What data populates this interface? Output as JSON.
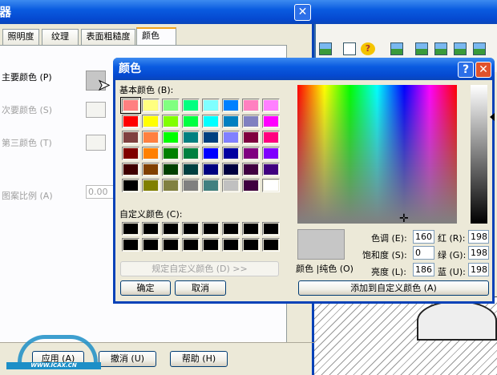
{
  "bg_dialog": {
    "title": "辑器",
    "tabs": [
      "照明度",
      "纹理",
      "表面粗糙度",
      "颜色"
    ],
    "primary_label": "主要颜色 (P)",
    "secondary_label": "次要颜色 (S)",
    "third_label": "第三颜色 (T)",
    "scale_label": "图案比例 (A)",
    "scale_value": "0.00",
    "apply": "应用 (A)",
    "undo": "撤消 (U)",
    "help": "帮助 (H)"
  },
  "color_dialog": {
    "title": "颜色",
    "basic_label": "基本颜色 (B):",
    "custom_label": "自定义颜色 (C):",
    "define_custom": "规定自定义颜色 (D) >>",
    "ok": "确定",
    "cancel": "取消",
    "preview_label": "颜色 |纯色 (O)",
    "hue_label": "色调 (E):",
    "hue": "160",
    "sat_label": "饱和度 (S):",
    "sat": "0",
    "lum_label": "亮度 (L):",
    "lum": "186",
    "red_label": "红 (R):",
    "red": "198",
    "green_label": "绿 (G):",
    "green": "198",
    "blue_label": "蓝 (U):",
    "blue": "198",
    "add_custom": "添加到自定义颜色 (A)",
    "basic_colors": [
      "#ff8080",
      "#ffff80",
      "#80ff80",
      "#00ff80",
      "#80ffff",
      "#0080ff",
      "#ff80c0",
      "#ff80ff",
      "#ff0000",
      "#ffff00",
      "#80ff00",
      "#00ff40",
      "#00ffff",
      "#0080c0",
      "#8080c0",
      "#ff00ff",
      "#804040",
      "#ff8040",
      "#00ff00",
      "#008080",
      "#004080",
      "#8080ff",
      "#800040",
      "#ff0080",
      "#800000",
      "#ff8000",
      "#008000",
      "#008040",
      "#0000ff",
      "#0000a0",
      "#800080",
      "#8000ff",
      "#400000",
      "#804000",
      "#004000",
      "#004040",
      "#000080",
      "#000040",
      "#400040",
      "#400080",
      "#000000",
      "#808000",
      "#808040",
      "#808080",
      "#408080",
      "#c0c0c0",
      "#400040",
      "#ffffff"
    ],
    "current_color": "#c6c6c6"
  },
  "watermark": "WWW.ICAX.CN"
}
